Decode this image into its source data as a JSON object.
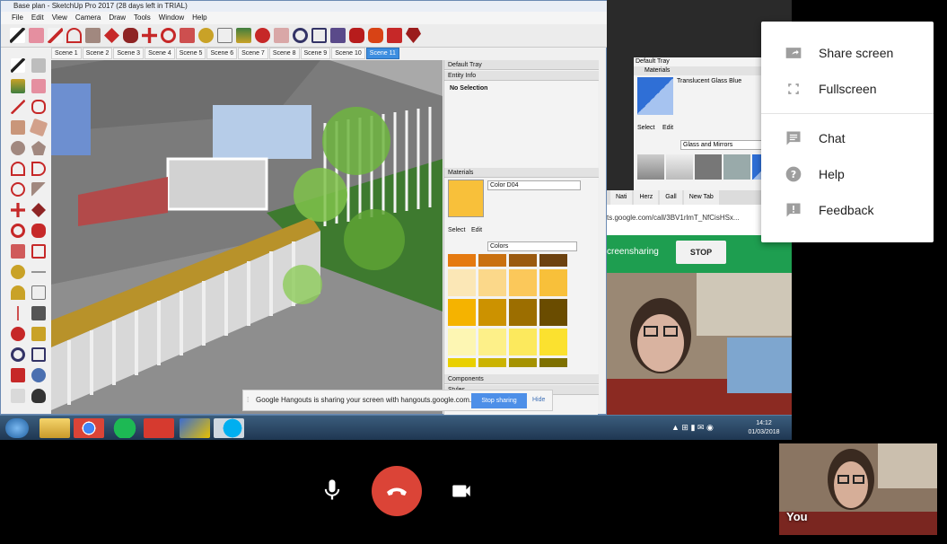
{
  "sketchup": {
    "title": "Base plan - SketchUp Pro 2017 (28 days left in TRIAL)",
    "menu": [
      "File",
      "Edit",
      "View",
      "Camera",
      "Draw",
      "Tools",
      "Window",
      "Help"
    ],
    "scenes": [
      "Scene 1",
      "Scene 2",
      "Scene 3",
      "Scene 4",
      "Scene 5",
      "Scene 6",
      "Scene 7",
      "Scene 8",
      "Scene 9",
      "Scene 10",
      "Scene 11"
    ],
    "active_scene": "Scene 11",
    "tray": {
      "title": "Default Tray",
      "entity_info": "Entity Info",
      "selection": "No Selection",
      "materials": "Materials",
      "material_name": "Color D04",
      "tab_select": "Select",
      "tab_edit": "Edit",
      "library": "Colors",
      "components": "Components",
      "styles": "Styles"
    }
  },
  "second_tray": {
    "title": "Default Tray",
    "materials": "Materials",
    "material_name": "Translucent Glass Blue",
    "tab_select": "Select",
    "tab_edit": "Edit",
    "library": "Glass and Mirrors"
  },
  "browser": {
    "tabs": [
      "Nati",
      "Herz",
      "Gall",
      "New Tab"
    ],
    "url": "ts.google.com/call/3BV1rlmT_NfCisHSx..."
  },
  "hangouts_bar": {
    "text": "creensharing",
    "stop": "STOP"
  },
  "notification": {
    "text": "Google Hangouts is sharing your screen with hangouts.google.com.",
    "stop_sharing": "Stop sharing",
    "hide": "Hide"
  },
  "taskbar": {
    "time": "14:12",
    "date": "01/03/2018"
  },
  "self_view": {
    "label": "You"
  },
  "menu": {
    "items": [
      {
        "label": "Share screen",
        "icon": "share-screen-icon"
      },
      {
        "label": "Fullscreen",
        "icon": "fullscreen-icon"
      },
      {
        "label": "Chat",
        "icon": "chat-icon"
      },
      {
        "label": "Help",
        "icon": "help-icon"
      },
      {
        "label": "Feedback",
        "icon": "feedback-icon"
      }
    ]
  },
  "colors": {
    "end_call": "#db4437",
    "hangouts_green": "#1e9e50",
    "scene_active": "#3d8ee0",
    "material_swatch": "#f8c03a"
  }
}
